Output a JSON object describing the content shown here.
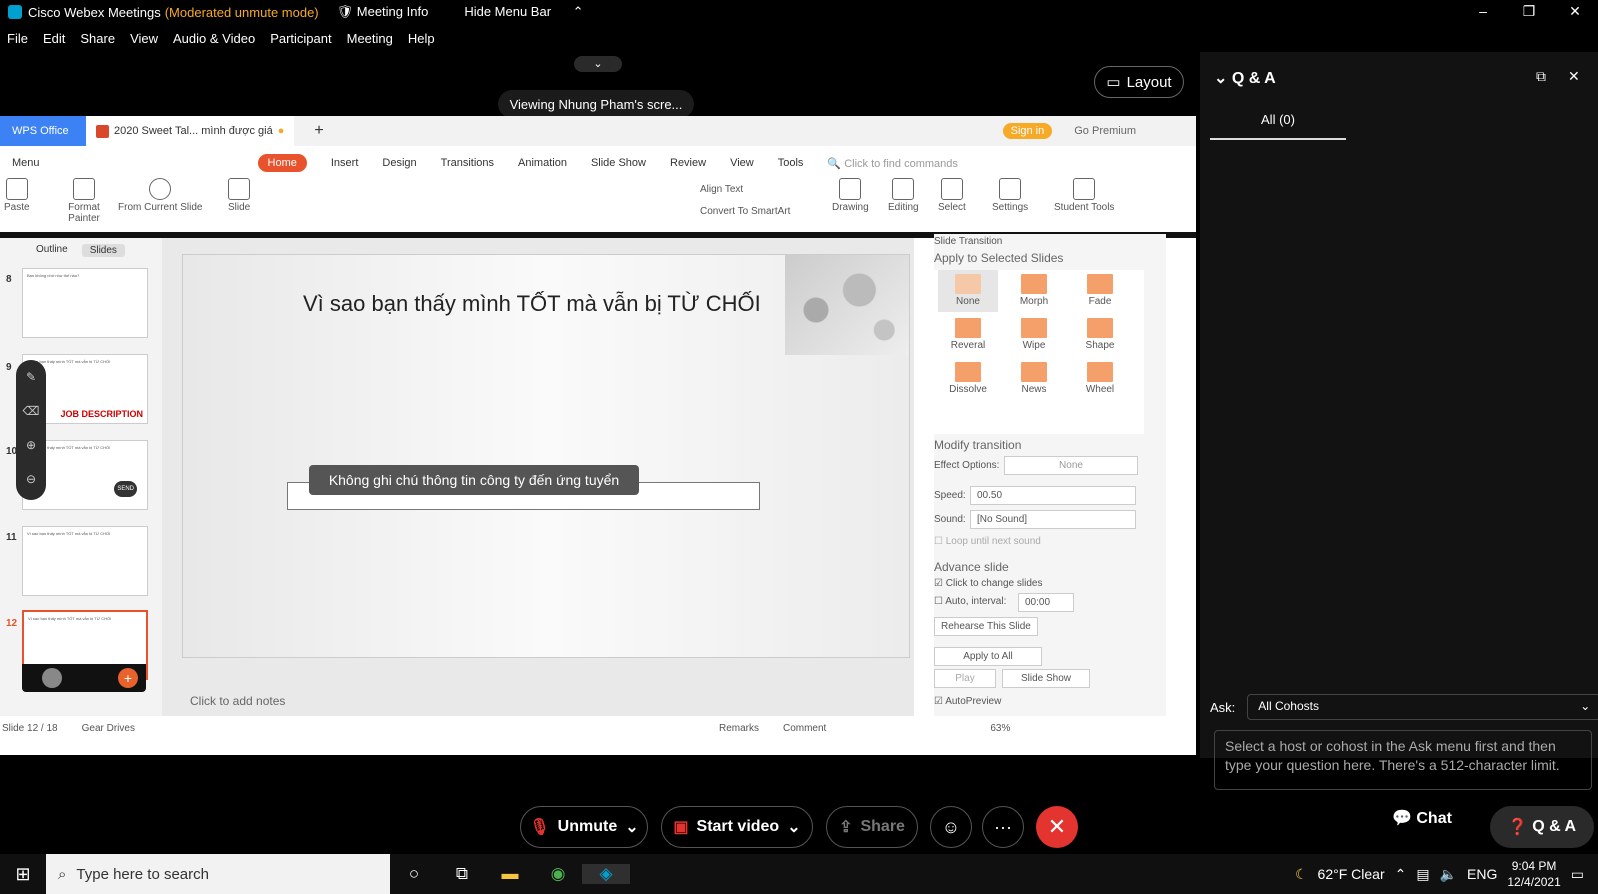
{
  "window": {
    "app": "Cisco Webex Meetings",
    "mode": "(Moderated unmute mode)",
    "meeting_info": "Meeting Info",
    "hide_menu": "Hide Menu Bar"
  },
  "menu": [
    "File",
    "Edit",
    "Share",
    "View",
    "Audio & Video",
    "Participant",
    "Meeting",
    "Help"
  ],
  "layout_label": "Layout",
  "viewing": "Viewing Nhung Pham's scre...",
  "wps": {
    "brand": "WPS Office",
    "doc_tab": "2020 Sweet Tal... mình được giá",
    "signin": "Sign in",
    "premium": "Go Premium",
    "ribbon_tabs": [
      "Menu",
      "Home",
      "Insert",
      "Design",
      "Transitions",
      "Animation",
      "Slide Show",
      "Review",
      "View",
      "Tools"
    ],
    "find": "Click to find commands",
    "ribbon": {
      "paste": "Paste",
      "format_painter": "Format Painter",
      "from_current": "From Current Slide",
      "slide": "Slide",
      "align_text": "Align Text",
      "convert": "Convert To SmartArt",
      "drawing": "Drawing",
      "editing": "Editing",
      "select": "Select",
      "settings": "Settings",
      "student_tools": "Student Tools"
    },
    "panel_tabs": {
      "outline": "Outline",
      "slides": "Slides"
    },
    "thumbs": [
      {
        "num": "8",
        "title": "Bạn không nhớ như thế nào?"
      },
      {
        "num": "9",
        "title": "Vì sao bạn thấy mình TỐT mà vẫn bị TỪ CHỐI",
        "label": "JOB DESCRIPTION"
      },
      {
        "num": "10",
        "title": "Vì sao bạn thấy mình TỐT mà vẫn bị TỪ CHỐI",
        "label": "SEND"
      },
      {
        "num": "11",
        "title": "Vì sao bạn thấy mình TỐT mà vẫn bị TỪ CHỐI"
      },
      {
        "num": "12",
        "title": "Vì sao bạn thấy mình TỐT mà vẫn bị TỪ CHỐI"
      }
    ],
    "slide_title": "Vì sao bạn thấy mình TỐT mà vẫn bị TỪ CHỐI",
    "tooltip": "Không ghi chú thông tin công ty đến ứng tuyển",
    "notes": "Click to add notes",
    "status": {
      "slide": "Slide 12 / 18",
      "theme": "Gear Drives",
      "remarks": "Remarks",
      "comment": "Comment",
      "zoom": "63%"
    },
    "transition": {
      "header": "Slide Transition",
      "apply_selected": "Apply to Selected Slides",
      "effects": [
        "None",
        "Morph",
        "Fade",
        "Reveral",
        "Wipe",
        "Shape",
        "Dissolve",
        "News",
        "Wheel"
      ],
      "modify": "Modify transition",
      "effect_options": "Effect Options:",
      "effect_value": "None",
      "speed_label": "Speed:",
      "speed_value": "00.50",
      "sound_label": "Sound:",
      "sound_value": "[No Sound]",
      "loop": "Loop until next sound",
      "advance": "Advance slide",
      "click_change": "Click to change slides",
      "auto_interval": "Auto, interval:",
      "interval_value": "00:00",
      "rehearse": "Rehearse This Slide",
      "apply_all": "Apply to All",
      "play": "Play",
      "slide_show": "Slide Show",
      "autopreview": "AutoPreview"
    }
  },
  "qa": {
    "title": "Q & A",
    "all_tab": "All (0)",
    "ask_label": "Ask:",
    "ask_value": "All Cohosts",
    "placeholder": "Select a host or cohost in the Ask menu first and then type your question here. There's a 512-character limit."
  },
  "controls": {
    "unmute": "Unmute",
    "start_video": "Start video",
    "share": "Share",
    "chat": "Chat",
    "qa": "Q & A"
  },
  "taskbar": {
    "search": "Type here to search",
    "weather": "62°F Clear",
    "lang": "ENG",
    "time": "9:04 PM",
    "date": "12/4/2021"
  }
}
